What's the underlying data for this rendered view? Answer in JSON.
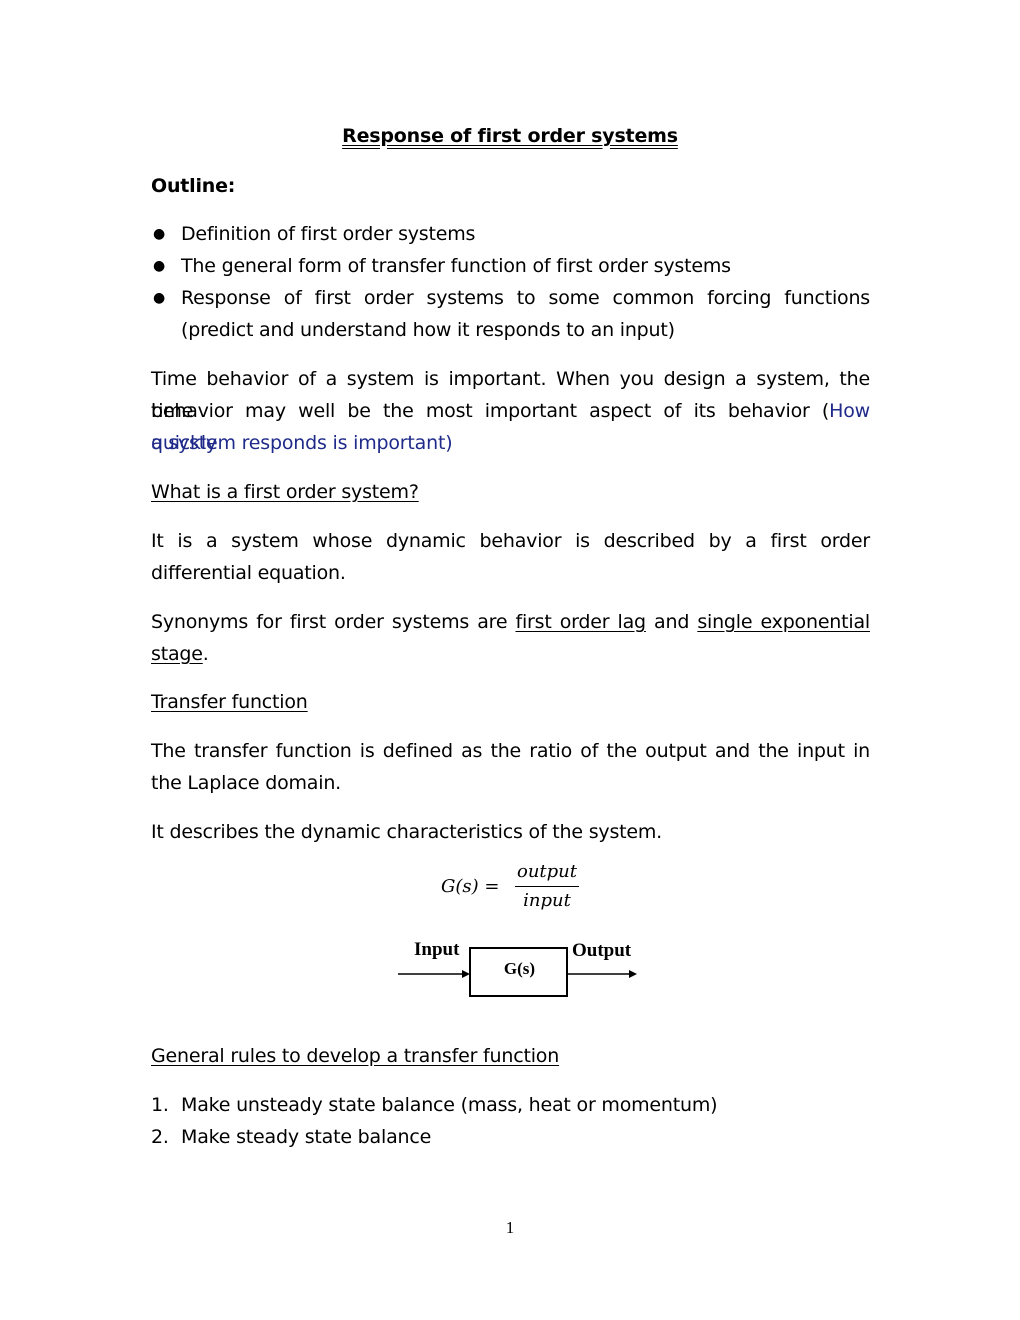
{
  "document": {
    "title": "Response of first order systems",
    "outline_heading": "Outline:",
    "outline_items": [
      "Definition of first order systems",
      "The general form of transfer function of first order systems",
      "Response of first order systems to some common forcing functions",
      "(predict and understand how it responds to an input)"
    ],
    "para1": {
      "line1": "Time behavior of a system is important.  When you design a system, the time",
      "line2_plain": "behavior may well be the most important aspect of its behavior (",
      "line2_blue": "How quickly",
      "line3_blue": "a system responds is important)"
    },
    "heading_what": "What is a first order system?",
    "para2": {
      "line1": "It is a system whose dynamic behavior is described by a first order",
      "line2": "differential equation."
    },
    "para3": {
      "prefix": "Synonyms for first order systems are ",
      "term1": "first order lag",
      "middle": " and ",
      "term2": "single exponential",
      "term2b": "stage",
      "suffix": "."
    },
    "heading_tf": "Transfer function",
    "para4": {
      "line1": "The transfer function is defined as the ratio of the output and the input in",
      "line2": "the Laplace domain."
    },
    "para5": "It describes the dynamic characteristics of the system.",
    "equation": {
      "lhs": "G(s) =",
      "numerator": "output",
      "denominator": "input"
    },
    "block_diagram": {
      "input_label": "Input",
      "block_label": "G(s)",
      "output_label": "Output"
    },
    "heading_rules": "General rules to develop a transfer function",
    "rules": [
      {
        "num": "1.",
        "text": "Make unsteady state balance (mass, heat or momentum)"
      },
      {
        "num": "2.",
        "text": "Make steady state balance"
      }
    ],
    "page_number": "1"
  }
}
